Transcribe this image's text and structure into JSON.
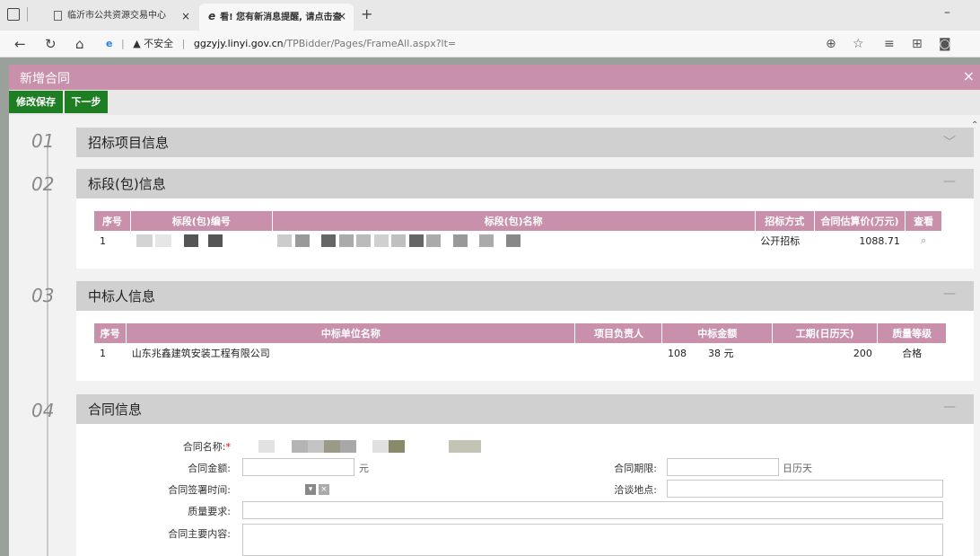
{
  "browser": {
    "tabs": [
      {
        "label": "临沂市公共资源交易中心",
        "close": "×"
      },
      {
        "label": "看! 您有新消息提醒, 请点击查",
        "close": "×"
      }
    ],
    "new_tab": "+",
    "address": {
      "insecure": "不安全",
      "host": "ggzyjy.linyi.gov.cn",
      "path": "/TPBidder/Pages/FrameAll.aspx?lt="
    }
  },
  "dialog": {
    "title": "新增合同",
    "close": "×",
    "toolbar": {
      "save": "修改保存",
      "next": "下一步"
    }
  },
  "sections": [
    {
      "num": "01",
      "title": "招标项目信息",
      "toggle": "﹀"
    },
    {
      "num": "02",
      "title": "标段(包)信息",
      "toggle": "—"
    },
    {
      "num": "03",
      "title": "中标人信息",
      "toggle": "—"
    },
    {
      "num": "04",
      "title": "合同信息",
      "toggle": "—"
    }
  ],
  "bid_section_table": {
    "headers": [
      "序号",
      "标段(包)编号",
      "标段(包)名称",
      "招标方式",
      "合同估算价(万元)",
      "查看"
    ],
    "rows": [
      {
        "index": "1",
        "method": "公开招标",
        "amount": "1088.71",
        "view_icon": "search-icon"
      }
    ]
  },
  "winner_table": {
    "headers": [
      "序号",
      "中标单位名称",
      "项目负责人",
      "中标金额",
      "工期(日历天)",
      "质量等级"
    ],
    "rows": [
      {
        "index": "1",
        "company": "山东兆鑫建筑安装工程有限公司",
        "amount_prefix": "108",
        "amount_suffix": "38 元",
        "days": "200",
        "quality": "合格"
      }
    ]
  },
  "contract_form": {
    "name_label": "合同名称:",
    "required_mark": "*",
    "amount_label": "合同金额:",
    "amount_unit": "元",
    "term_label": "合同期限:",
    "term_unit": "日历天",
    "sign_time_label": "合同签署时间:",
    "negotiate_place_label": "洽谈地点:",
    "quality_label": "质量要求:",
    "content_label": "合同主要内容:"
  },
  "colors": {
    "accent": "#c890aa",
    "button": "#1e7e23",
    "header_gray": "#d0d0d0"
  }
}
